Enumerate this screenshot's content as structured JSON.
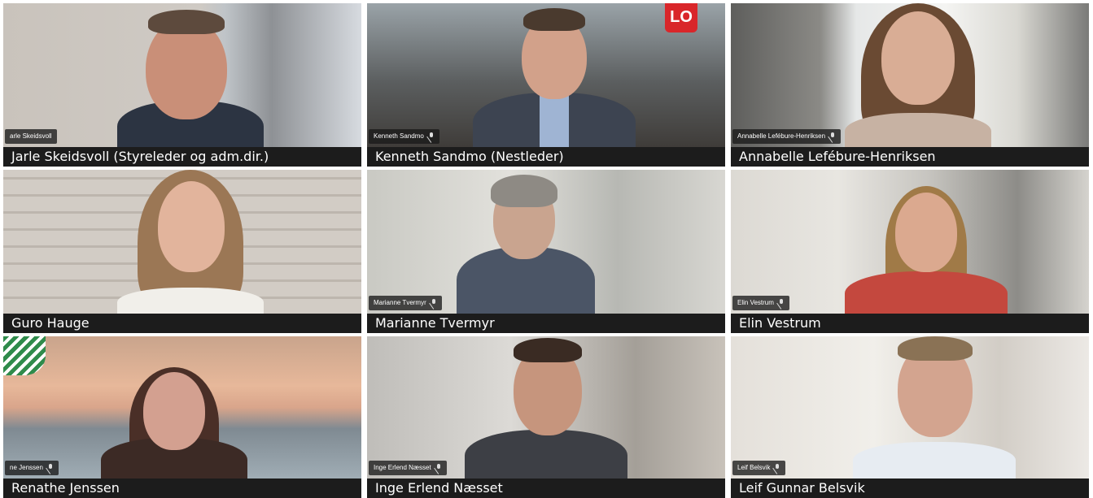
{
  "participants": [
    {
      "name": "Jarle Skeidsvoll (Styreleder og adm.dir.)",
      "overlay": "arle Skeidsvoll",
      "muted": false
    },
    {
      "name": "Kenneth Sandmo (Nestleder)",
      "overlay": "Kenneth Sandmo",
      "muted": true
    },
    {
      "name": "Annabelle Lefébure-Henriksen",
      "overlay": "Annabelle Lefébure-Henriksen",
      "muted": true
    },
    {
      "name": "Guro Hauge",
      "overlay": "",
      "muted": false
    },
    {
      "name": "Marianne Tvermyr",
      "overlay": "Marianne Tvermyr",
      "muted": true
    },
    {
      "name": "Elin Vestrum",
      "overlay": "Elin Vestrum",
      "muted": true
    },
    {
      "name": "Renathe Jenssen",
      "overlay": "ne Jenssen",
      "muted": true
    },
    {
      "name": "Inge Erlend Næsset",
      "overlay": "Inge Erlend Næsset",
      "muted": true
    },
    {
      "name": "Leif Gunnar Belsvik",
      "overlay": "Leif Belsvik",
      "muted": true
    }
  ],
  "logos": {
    "lo": "LO"
  },
  "colors": {
    "caption_bg": "#1c1c1c",
    "caption_text": "#ffffff",
    "lo_red": "#d9262a",
    "swan_green": "#2f8b4b"
  }
}
